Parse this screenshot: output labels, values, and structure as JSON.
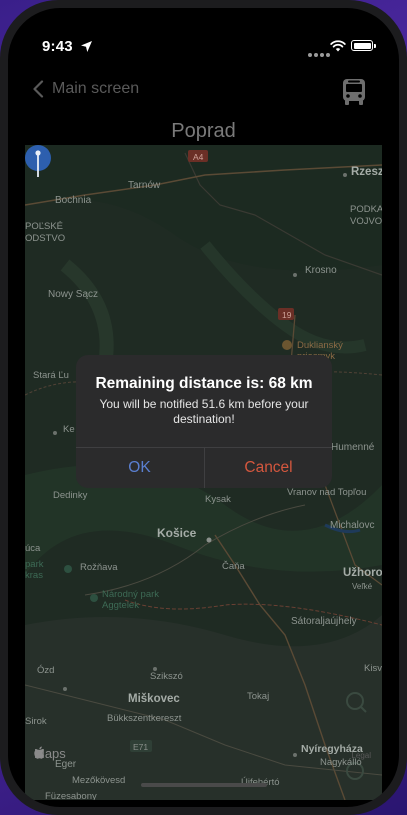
{
  "status": {
    "time": "9:43"
  },
  "nav": {
    "back_label": "Main screen",
    "title": "Poprad"
  },
  "map": {
    "roads": {
      "A4": "A4",
      "19": "19",
      "E71": "E71"
    },
    "places": {
      "rzeszow": "Rzeszó",
      "tarnow": "Tarnów",
      "bochnia": "Bochnia",
      "podkarpackie": "PODKAR",
      "podkarpackie2": "VOJVO",
      "polske": "POĽSKÉ",
      "polske2": "ODSTVO",
      "krosno": "Krosno",
      "nowy_sacz": "Nowy Sącz",
      "duklianski": "Duklianský",
      "duklianski2": "priesmyk",
      "stara": "Stará Ľu",
      "ke": "Ke",
      "humenne": "Humenné",
      "vranov": "Vranov nad Topľou",
      "dedinky": "Dedinky",
      "kysak": "Kysak",
      "michalovce": "Michalovc",
      "kosice": "Košice",
      "uzhorod": "Užhoro",
      "velke": "Veľké",
      "cana": "Čaňa",
      "roznava": "Rožňava",
      "ruca": "úca",
      "park": "park",
      "kras": "kras",
      "aggtelek": "Národný park",
      "aggtelek2": "Aggtelek",
      "satoral": "Sátoraljaújhely",
      "ozd": "Ózd",
      "kisv": "Kisv",
      "szikszo": "Szikszó",
      "tokaj": "Tokaj",
      "miskovec": "Miškovec",
      "bukk": "Bükkszentkereszt",
      "siroki": "Sirok",
      "eger": "Eger",
      "nyireg": "Nyíregyháza",
      "nagykallo": "Nagykálló",
      "mezokov": "Mezőkövesd",
      "ujfeherto": "Újfehértó",
      "fuzes": "Füzesabony"
    },
    "logo": "Maps",
    "legal": "Legal"
  },
  "alert": {
    "title": "Remaining distance is: 68 km",
    "message": "You will be notified 51.6 km before your destination!",
    "ok": "OK",
    "cancel": "Cancel"
  },
  "colors": {
    "ok": "#5a7fd0",
    "cancel": "#d4573e",
    "map_bg": "#1e2a22"
  }
}
